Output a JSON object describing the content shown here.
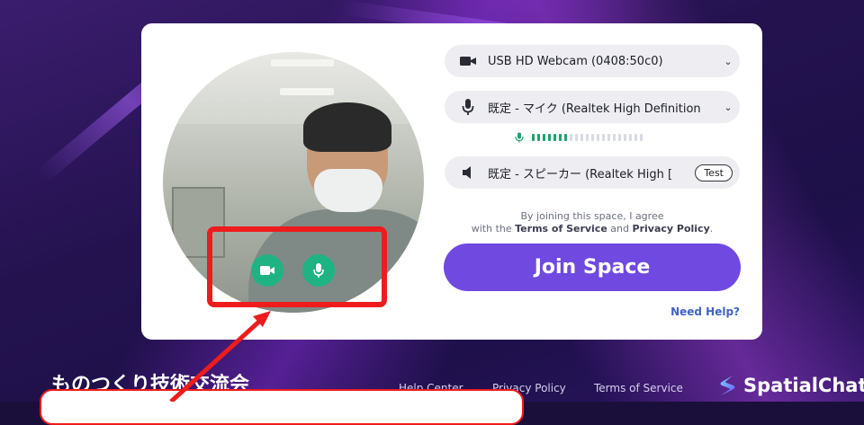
{
  "media": {
    "camera": {
      "label": "USB HD Webcam (0408:50c0)"
    },
    "microphone": {
      "label": "既定 - マイク (Realtek High Definition",
      "level_fraction": 0.33
    },
    "speaker": {
      "label": "既定 - スピーカー (Realtek High [",
      "test_label": "Test"
    }
  },
  "agreement": {
    "line1": "By joining this space, I agree",
    "line2_prefix": "with the ",
    "terms": "Terms of Service",
    "and": " and ",
    "privacy": "Privacy Policy",
    "suffix": "."
  },
  "join_label": "Join Space",
  "help_label": "Need Help?",
  "footer": {
    "title": "ものつくり技術交流会",
    "links": [
      "Help Center",
      "Privacy Policy",
      "Terms of Service"
    ],
    "brand": "SpatialChat"
  },
  "colors": {
    "accent": "#6f49e0",
    "media_on": "#1fb383",
    "annotation": "#ee1c1c"
  },
  "icons": [
    "video-camera-icon",
    "microphone-icon",
    "speaker-icon",
    "chevron-down-icon",
    "spatialchat-logo-icon"
  ]
}
